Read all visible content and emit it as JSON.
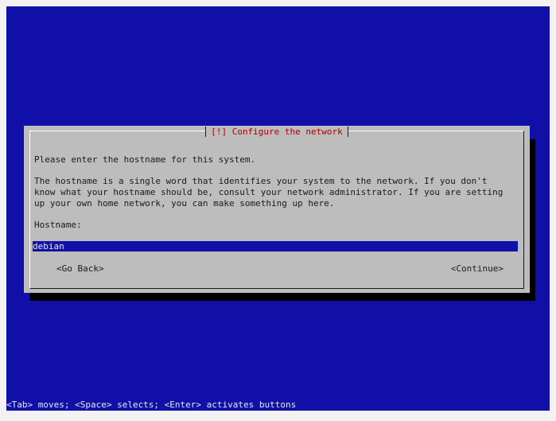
{
  "dialog": {
    "title": "[!] Configure the network",
    "prompt": "Please enter the hostname for this system.",
    "description": "The hostname is a single word that identifies your system to the network. If you don't\nknow what your hostname should be, consult your network administrator. If you are setting\nup your own home network, you can make something up here.",
    "hostname_label": "Hostname:",
    "hostname_value": "debian",
    "go_back_label": "<Go Back>",
    "continue_label": "<Continue>"
  },
  "help_bar": {
    "text": "<Tab> moves; <Space> selects; <Enter> activates buttons"
  },
  "colors": {
    "screen_bg": "#1010a8",
    "dialog_bg": "#bdbdbd",
    "title_fg": "#b00000"
  }
}
